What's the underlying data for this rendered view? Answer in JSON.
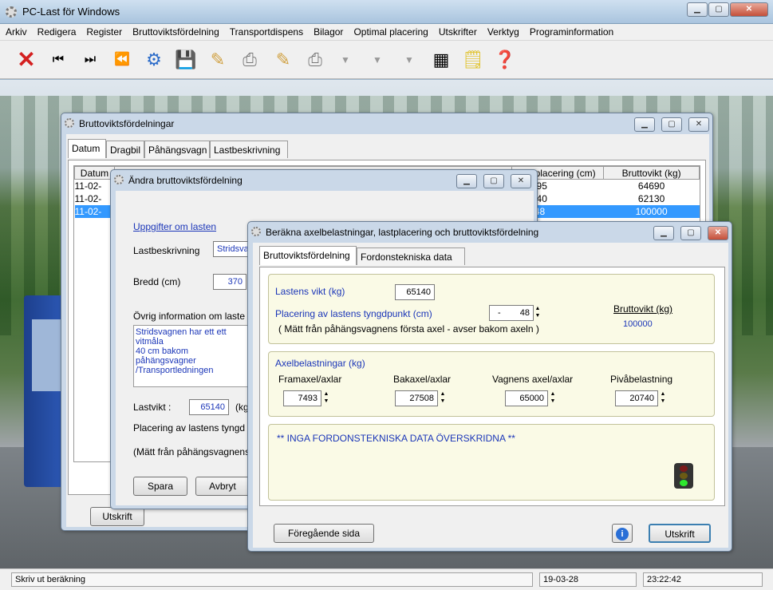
{
  "app": {
    "title": "PC-Last för Windows"
  },
  "menu": [
    "Arkiv",
    "Redigera",
    "Register",
    "Bruttoviktsfördelning",
    "Transportdispens",
    "Bilagor",
    "Optimal placering",
    "Utskrifter",
    "Verktyg",
    "Programinformation"
  ],
  "toolbar": [
    "close-icon",
    "first-record-icon",
    "last-record-icon",
    "previous-icon",
    "settings-icon",
    "save-icon",
    "edit-icon",
    "print-icon",
    "edit-icon",
    "print-icon",
    "down-arrow-icon",
    "down-arrow-icon",
    "down-arrow-icon",
    "calculator-icon",
    "notes-icon",
    "help-icon"
  ],
  "status": {
    "text": "Skriv ut beräkning",
    "date": "19-03-28",
    "time": "23:22:42"
  },
  "win1": {
    "title": "Bruttoviktsfördelningar",
    "tabs": [
      "Datum",
      "Dragbil",
      "Påhängsvagn",
      "Lastbeskrivning"
    ],
    "col_datum": "Datum",
    "col_lastplacering": "lastplacering (cm)",
    "col_bruttovikt": "Bruttovikt (kg)",
    "rows": [
      {
        "datum": "11-02-",
        "placering": "495",
        "bruttovikt": "64690"
      },
      {
        "datum": "11-02-",
        "placering": "440",
        "bruttovikt": "62130"
      },
      {
        "datum": "11-02-",
        "placering": "-48",
        "bruttovikt": "100000"
      }
    ],
    "utskrift": "Utskrift"
  },
  "win2": {
    "title": "Ändra bruttoviktsfördelning",
    "uppgifter": "Uppgifter om lasten",
    "lastbeskrivning_label": "Lastbeskrivning",
    "lastbeskrivning_value": "Stridsvag",
    "bredd_label": "Bredd (cm)",
    "bredd_value": "370",
    "ovrig_label": "Övrig information om laste",
    "ovrig_text1": "Stridsvagnen har ett ett vitmåla",
    "ovrig_text2": "40 cm bakom påhängsvagner",
    "ovrig_text3": "/Transportledningen",
    "lastvikt_label": "Lastvikt :",
    "lastvikt_value": "65140",
    "lastvikt_unit": "(kg",
    "placering_label": "Placering av lastens tyngd",
    "matt_label": "(Mätt från påhängsvagnens",
    "spara": "Spara",
    "avbryt": "Avbryt"
  },
  "win3": {
    "title": "Beräkna axelbelastningar, lastplacering och bruttoviktsfördelning",
    "tabs": [
      "Bruttoviktsfördelning",
      "Fordonstekniska data"
    ],
    "lastens_vikt_label": "Lastens vikt (kg)",
    "lastens_vikt_value": "65140",
    "placering_label": "Placering av lastens tyngdpunkt (cm)",
    "placering_sign": "-",
    "placering_value": "48",
    "matt_label": "( Mätt från påhängsvagnens första axel   - avser bakom axeln )",
    "bruttovikt_label": "Bruttovikt (kg)",
    "bruttovikt_value": "100000",
    "axel_header": "Axelbelastningar (kg)",
    "axles": [
      {
        "label": "Framaxel/axlar",
        "value": "7493"
      },
      {
        "label": "Bakaxel/axlar",
        "value": "27508"
      },
      {
        "label": "Vagnens axel/axlar",
        "value": "65000"
      },
      {
        "label": "Pivåbelastning",
        "value": "20740"
      }
    ],
    "message": "** INGA FORDONSTEKNISKA DATA ÖVERSKRIDNA **",
    "foregaende": "Föregående sida",
    "utskrift": "Utskrift",
    "info_icon": "info-icon",
    "traffic_light": "traffic-light-icon"
  }
}
